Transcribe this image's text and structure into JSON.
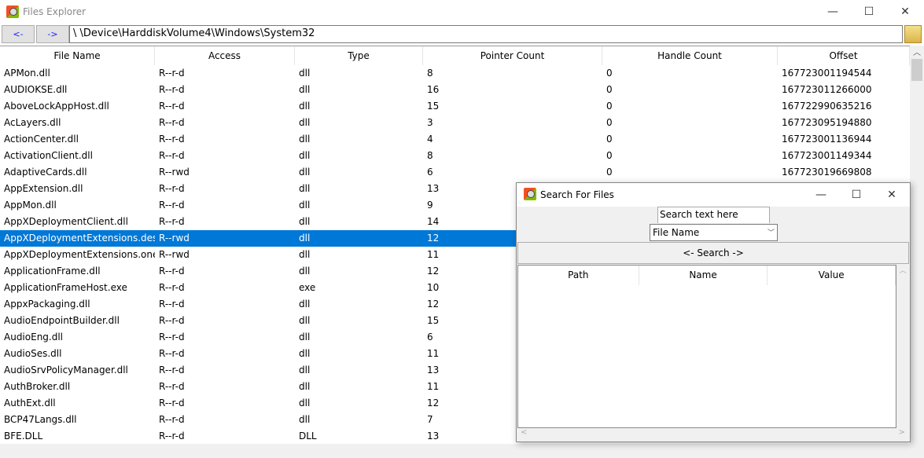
{
  "window": {
    "title": "Files Explorer",
    "minimize": "—",
    "maximize": "☐",
    "close": "✕"
  },
  "toolbar": {
    "back": "<-",
    "forward": "->",
    "path": "\\ \\Device\\HarddiskVolume4\\Windows\\System32"
  },
  "table": {
    "columns": [
      "File Name",
      "Access",
      "Type",
      "Pointer Count",
      "Handle Count",
      "Offset"
    ],
    "selected_index": 10,
    "rows": [
      [
        "APMon.dll",
        "R--r-d",
        "dll",
        "8",
        "0",
        "167723001194544"
      ],
      [
        "AUDIOKSE.dll",
        "R--r-d",
        "dll",
        "16",
        "0",
        "167723011266000"
      ],
      [
        "AboveLockAppHost.dll",
        "R--r-d",
        "dll",
        "15",
        "0",
        "167722990635216"
      ],
      [
        "AcLayers.dll",
        "R--r-d",
        "dll",
        "3",
        "0",
        "167723095194880"
      ],
      [
        "ActionCenter.dll",
        "R--r-d",
        "dll",
        "4",
        "0",
        "167723001136944"
      ],
      [
        "ActivationClient.dll",
        "R--r-d",
        "dll",
        "8",
        "0",
        "167723001149344"
      ],
      [
        "AdaptiveCards.dll",
        "R--rwd",
        "dll",
        "6",
        "0",
        "167723019669808"
      ],
      [
        "AppExtension.dll",
        "R--r-d",
        "dll",
        "13",
        "",
        ""
      ],
      [
        "AppMon.dll",
        "R--r-d",
        "dll",
        "9",
        "",
        ""
      ],
      [
        "AppXDeploymentClient.dll",
        "R--r-d",
        "dll",
        "14",
        "",
        ""
      ],
      [
        "AppXDeploymentExtensions.des",
        "R--rwd",
        "dll",
        "12",
        "",
        ""
      ],
      [
        "AppXDeploymentExtensions.one",
        "R--rwd",
        "dll",
        "11",
        "",
        ""
      ],
      [
        "ApplicationFrame.dll",
        "R--r-d",
        "dll",
        "12",
        "",
        ""
      ],
      [
        "ApplicationFrameHost.exe",
        "R--r-d",
        "exe",
        "10",
        "",
        ""
      ],
      [
        "AppxPackaging.dll",
        "R--r-d",
        "dll",
        "12",
        "",
        ""
      ],
      [
        "AudioEndpointBuilder.dll",
        "R--r-d",
        "dll",
        "15",
        "",
        ""
      ],
      [
        "AudioEng.dll",
        "R--r-d",
        "dll",
        "6",
        "",
        ""
      ],
      [
        "AudioSes.dll",
        "R--r-d",
        "dll",
        "11",
        "",
        ""
      ],
      [
        "AudioSrvPolicyManager.dll",
        "R--r-d",
        "dll",
        "13",
        "",
        ""
      ],
      [
        "AuthBroker.dll",
        "R--r-d",
        "dll",
        "11",
        "",
        ""
      ],
      [
        "AuthExt.dll",
        "R--r-d",
        "dll",
        "12",
        "",
        ""
      ],
      [
        "BCP47Langs.dll",
        "R--r-d",
        "dll",
        "7",
        "",
        ""
      ],
      [
        "BFE.DLL",
        "R--r-d",
        "DLL",
        "13",
        "",
        ""
      ]
    ]
  },
  "search_dialog": {
    "title": "Search For Files",
    "minimize": "—",
    "maximize": "☐",
    "close": "✕",
    "search_input": "Search text here",
    "field_select": "File Name",
    "search_button": "<- Search ->",
    "result_columns": [
      "Path",
      "Name",
      "Value"
    ]
  },
  "colors": {
    "selection": "#0078d7",
    "nav_text": "#1a1aff"
  }
}
